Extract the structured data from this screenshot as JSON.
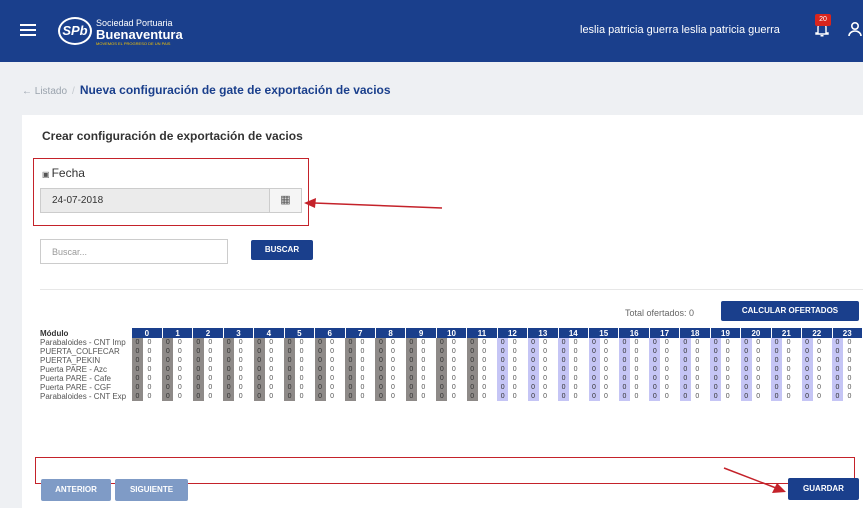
{
  "header": {
    "menu_icon": "hamburger-icon",
    "logo_mark": "SPb",
    "logo_small": "Sociedad Portuaria",
    "logo_big": "Buenaventura",
    "logo_tagline": "MOVEMOS EL PROGRESO DE UN PAIS",
    "username": "leslia patricia guerra leslia patricia guerra",
    "notification_count": "20",
    "bell_icon": "bell-icon",
    "user_icon": "user-icon",
    "colors": {
      "bar": "#1a3f8c",
      "badge": "#d9251d"
    }
  },
  "breadcrumb": {
    "back": "← Listado",
    "separator": "/",
    "current": "Nueva configuración de gate de exportación de vacios"
  },
  "form": {
    "title": "Crear configuración de exportación de vacios",
    "fecha_label": "Fecha",
    "fecha_value": "24-07-2018",
    "calendar_icon": "calendar-icon",
    "search_placeholder": "Buscar...",
    "search_button": "BUSCAR",
    "total_label": "Total ofertados: 0",
    "calc_button": "CALCULAR OFERTADOS",
    "module_header": "Módulo",
    "hours": [
      "0",
      "1",
      "2",
      "3",
      "4",
      "5",
      "6",
      "7",
      "8",
      "9",
      "10",
      "11",
      "12",
      "13",
      "14",
      "15",
      "16",
      "17",
      "18",
      "19",
      "20",
      "21",
      "22",
      "23"
    ],
    "modules": [
      {
        "name": "Parabaloides - CNT Imp",
        "values": [
          "0",
          "0",
          "0",
          "0",
          "0",
          "0",
          "0",
          "0",
          "0",
          "0",
          "0",
          "0",
          "0",
          "0",
          "0",
          "0",
          "0",
          "0",
          "0",
          "0",
          "0",
          "0",
          "0",
          "0"
        ]
      },
      {
        "name": "PUERTA_COLFECAR",
        "values": [
          "0",
          "0",
          "0",
          "0",
          "0",
          "0",
          "0",
          "0",
          "0",
          "0",
          "0",
          "0",
          "0",
          "0",
          "0",
          "0",
          "0",
          "0",
          "0",
          "0",
          "0",
          "0",
          "0",
          "0"
        ]
      },
      {
        "name": "PUERTA_PEKIN",
        "values": [
          "0",
          "0",
          "0",
          "0",
          "0",
          "0",
          "0",
          "0",
          "0",
          "0",
          "0",
          "0",
          "0",
          "0",
          "0",
          "0",
          "0",
          "0",
          "0",
          "0",
          "0",
          "0",
          "0",
          "0"
        ]
      },
      {
        "name": "Puerta PARE - Azc",
        "values": [
          "0",
          "0",
          "0",
          "0",
          "0",
          "0",
          "0",
          "0",
          "0",
          "0",
          "0",
          "0",
          "0",
          "0",
          "0",
          "0",
          "0",
          "0",
          "0",
          "0",
          "0",
          "0",
          "0",
          "0"
        ]
      },
      {
        "name": "Puerta PARE - Cafe",
        "values": [
          "0",
          "0",
          "0",
          "0",
          "0",
          "0",
          "0",
          "0",
          "0",
          "0",
          "0",
          "0",
          "0",
          "0",
          "0",
          "0",
          "0",
          "0",
          "0",
          "0",
          "0",
          "0",
          "0",
          "0"
        ]
      },
      {
        "name": "Puerta PARE - CGF",
        "values": [
          "0",
          "0",
          "0",
          "0",
          "0",
          "0",
          "0",
          "0",
          "0",
          "0",
          "0",
          "0",
          "0",
          "0",
          "0",
          "0",
          "0",
          "0",
          "0",
          "0",
          "0",
          "0",
          "0",
          "0"
        ]
      },
      {
        "name": "Parabaloides - CNT Exp",
        "values": [
          "0",
          "0",
          "0",
          "0",
          "0",
          "0",
          "0",
          "0",
          "0",
          "0",
          "0",
          "0",
          "0",
          "0",
          "0",
          "0",
          "0",
          "0",
          "0",
          "0",
          "0",
          "0",
          "0",
          "0"
        ]
      }
    ],
    "disabled_hours": 12,
    "colors": {
      "disabled_cell": "#8e8a88",
      "enabled_cell": "#c5c5f5",
      "hour_header": "#1a3f8c",
      "highlight": "#c4222a"
    },
    "prev_button": "ANTERIOR",
    "next_button": "SIGUIENTE",
    "save_button": "GUARDAR"
  }
}
